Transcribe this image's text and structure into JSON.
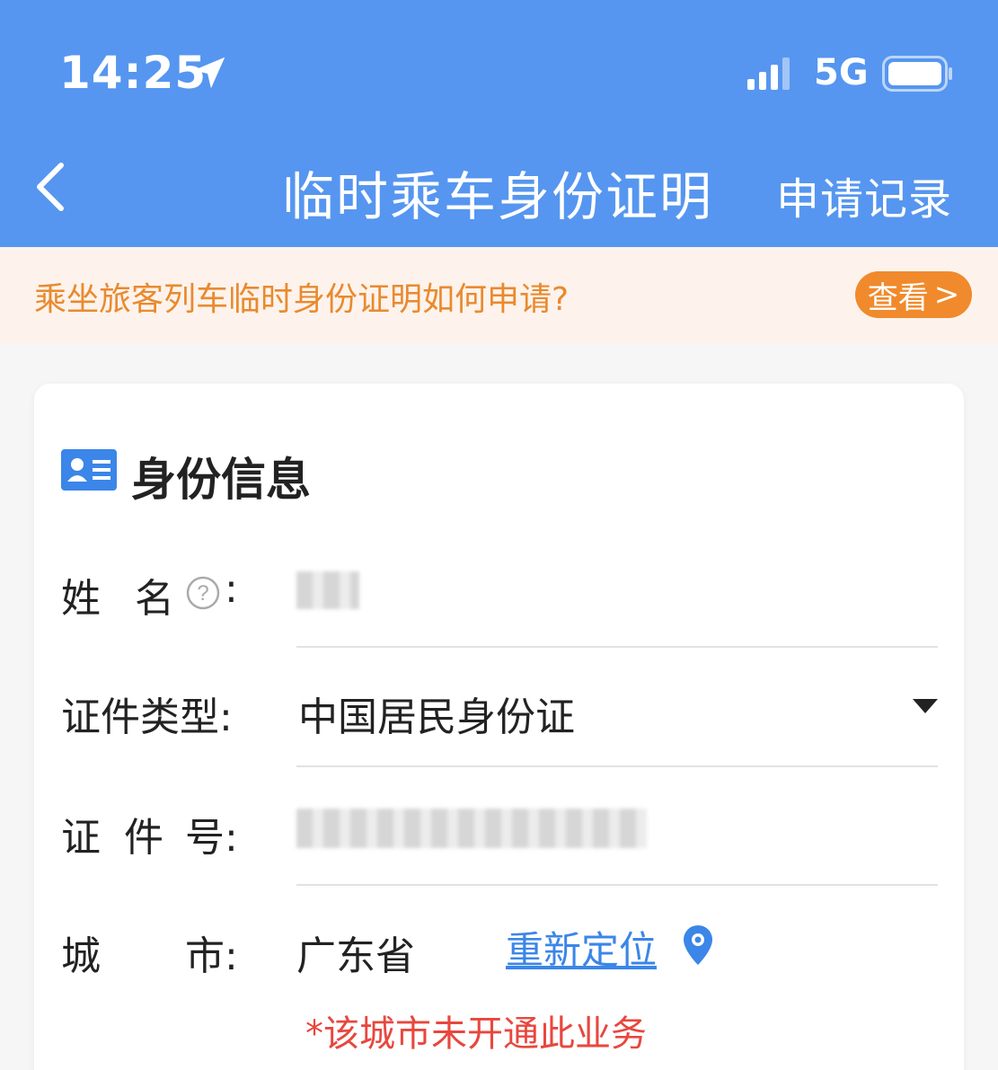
{
  "status_bar": {
    "time": "14:25",
    "network": "5G"
  },
  "nav": {
    "title": "临时乘车身份证明",
    "right_action": "申请记录"
  },
  "notice": {
    "text": "乘坐旅客列车临时身份证明如何申请?",
    "button_label": "查看",
    "button_chevron": ">"
  },
  "form": {
    "section_title": "身份信息",
    "name_label_a": "姓",
    "name_label_b": "名",
    "colon": ":",
    "id_type_label": "证件类型:",
    "id_type_value": "中国居民身份证",
    "id_number_label_a": "证",
    "id_number_label_b": "件",
    "id_number_label_c": "号:",
    "city_label_a": "城",
    "city_label_b": "市:",
    "city_value": "广东省",
    "relocate_label": "重新定位",
    "city_warning": "*该城市未开通此业务"
  },
  "colors": {
    "header_bg": "#5696f0",
    "notice_bg": "#fdf3ec",
    "notice_text": "#e98a2f",
    "notice_button": "#f08a2c",
    "link": "#3b86e8",
    "warning": "#e8473e"
  },
  "icons": {
    "back": "chevron-left-icon",
    "location_arrow": "location-arrow-icon",
    "signal": "signal-icon",
    "battery": "battery-icon",
    "id_card": "id-card-icon",
    "help": "question-circle-icon",
    "dropdown": "caret-down-icon",
    "pin": "map-pin-icon"
  }
}
